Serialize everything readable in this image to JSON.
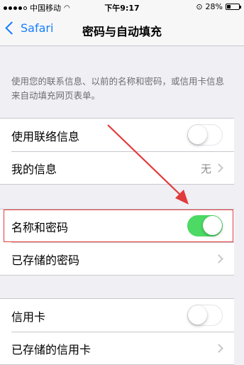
{
  "status_bar": {
    "carrier": "中国移动",
    "time": "下午9:17",
    "battery": "28%"
  },
  "nav": {
    "back_label": "Safari",
    "title": "密码与自动填充"
  },
  "description": "使用您的联系信息、以前的名称和密码，或信用卡信息来自动填充网页表单。",
  "group1": {
    "use_contact_info": {
      "label": "使用联络信息",
      "enabled": false
    },
    "my_info": {
      "label": "我的信息",
      "value": "无"
    }
  },
  "group2": {
    "names_passwords": {
      "label": "名称和密码",
      "enabled": true
    },
    "saved_passwords": {
      "label": "已存储的密码"
    }
  },
  "group3": {
    "credit_cards": {
      "label": "信用卡",
      "enabled": false
    },
    "saved_credit_cards": {
      "label": "已存储的信用卡"
    }
  },
  "colors": {
    "accent": "#157efb",
    "toggle_on": "#4cd964",
    "annotation": "#e23b3b"
  }
}
